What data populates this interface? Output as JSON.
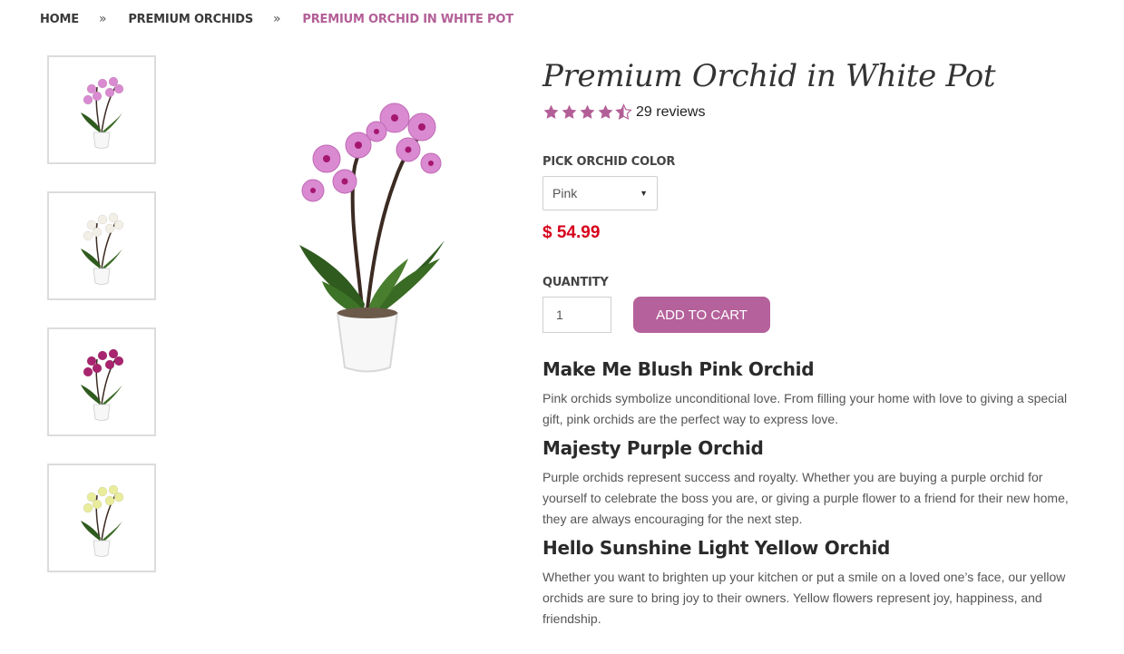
{
  "breadcrumb": {
    "home": "HOME",
    "category": "PREMIUM ORCHIDS",
    "current": "PREMIUM ORCHID IN WHITE POT",
    "separator": "»"
  },
  "thumbnails": [
    {
      "color_name": "pink",
      "flower_color": "#d98ad0"
    },
    {
      "color_name": "white",
      "flower_color": "#f2efe6"
    },
    {
      "color_name": "purple",
      "flower_color": "#a8246e"
    },
    {
      "color_name": "yellow",
      "flower_color": "#e9ec9b"
    }
  ],
  "product": {
    "title": "Premium Orchid in White Pot",
    "rating": 4.5,
    "reviews_label": "29 reviews",
    "color_label": "PICK ORCHID COLOR",
    "selected_color": "Pink",
    "price": "$ 54.99",
    "quantity_label": "QUANTITY",
    "quantity_value": "1",
    "add_to_cart": "ADD TO CART"
  },
  "descriptions": [
    {
      "heading": "Make Me Blush Pink Orchid",
      "text": "Pink orchids symbolize unconditional love. From filling your home with love to giving a special gift, pink orchids are the perfect way to express love."
    },
    {
      "heading": "Majesty Purple Orchid",
      "text": "Purple orchids represent success and royalty. Whether you are buying a purple orchid for yourself to celebrate the boss you are, or giving a purple flower to a friend for their new home, they are always encouraging for the next step."
    },
    {
      "heading": "Hello Sunshine Light Yellow Orchid",
      "text": "Whether you want to brighten up your kitchen or put a smile on a loved one’s face, our yellow orchids are sure to bring joy to their owners. Yellow flowers represent joy, happiness, and friendship."
    }
  ],
  "colors": {
    "accent": "#b5619b",
    "breadcrumb_current": "#b35f97",
    "price": "#d6001c",
    "star": "#b35f97"
  }
}
